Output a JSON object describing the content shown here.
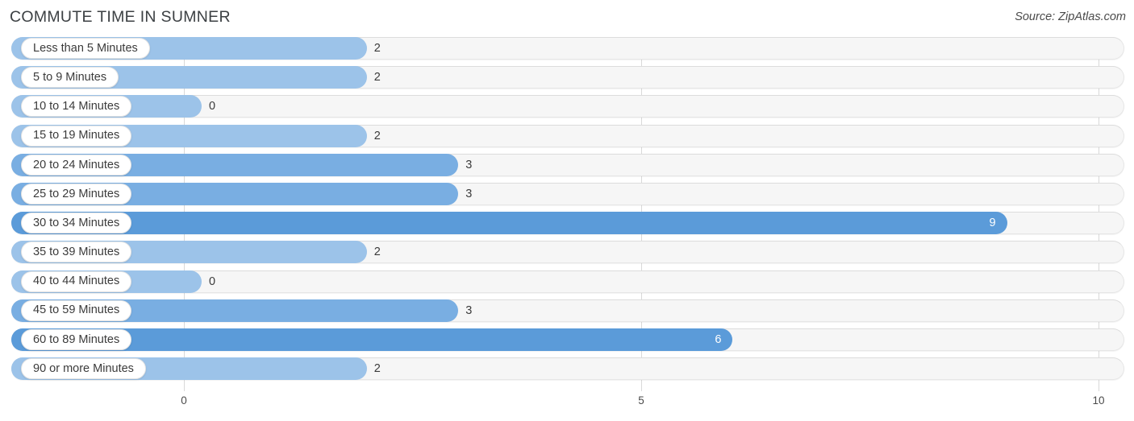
{
  "header": {
    "title": "COMMUTE TIME IN SUMNER",
    "source": "Source: ZipAtlas.com"
  },
  "axis": {
    "ticks": [
      "0",
      "5",
      "10"
    ],
    "tick_values": [
      0,
      5,
      10
    ]
  },
  "colors": {
    "bar_light": "#9cc3e9",
    "bar_mid": "#79aee2",
    "bar_dark": "#5b9bd9",
    "track": "#f6f6f6",
    "gridline": "#d9d9d9",
    "text": "#3b3b3b"
  },
  "chart_data": {
    "type": "bar",
    "title": "COMMUTE TIME IN SUMNER",
    "orientation": "horizontal",
    "xlabel": "",
    "ylabel": "",
    "xlim": [
      0,
      10
    ],
    "grid": true,
    "legend": "none",
    "categories": [
      "Less than 5 Minutes",
      "5 to 9 Minutes",
      "10 to 14 Minutes",
      "15 to 19 Minutes",
      "20 to 24 Minutes",
      "25 to 29 Minutes",
      "30 to 34 Minutes",
      "35 to 39 Minutes",
      "40 to 44 Minutes",
      "45 to 59 Minutes",
      "60 to 89 Minutes",
      "90 or more Minutes"
    ],
    "values": [
      2,
      2,
      0,
      2,
      3,
      3,
      9,
      2,
      0,
      3,
      6,
      2
    ],
    "value_labels": [
      "2",
      "2",
      "0",
      "2",
      "3",
      "3",
      "9",
      "2",
      "0",
      "3",
      "6",
      "2"
    ]
  },
  "rows": [
    {
      "label": "Less than 5 Minutes",
      "value": 2,
      "value_label": "2",
      "shade": "light",
      "label_inside": false
    },
    {
      "label": "5 to 9 Minutes",
      "value": 2,
      "value_label": "2",
      "shade": "light",
      "label_inside": false
    },
    {
      "label": "10 to 14 Minutes",
      "value": 0,
      "value_label": "0",
      "shade": "light",
      "label_inside": false
    },
    {
      "label": "15 to 19 Minutes",
      "value": 2,
      "value_label": "2",
      "shade": "light",
      "label_inside": false
    },
    {
      "label": "20 to 24 Minutes",
      "value": 3,
      "value_label": "3",
      "shade": "mid",
      "label_inside": false
    },
    {
      "label": "25 to 29 Minutes",
      "value": 3,
      "value_label": "3",
      "shade": "mid",
      "label_inside": false
    },
    {
      "label": "30 to 34 Minutes",
      "value": 9,
      "value_label": "9",
      "shade": "dark",
      "label_inside": true
    },
    {
      "label": "35 to 39 Minutes",
      "value": 2,
      "value_label": "2",
      "shade": "light",
      "label_inside": false
    },
    {
      "label": "40 to 44 Minutes",
      "value": 0,
      "value_label": "0",
      "shade": "light",
      "label_inside": false
    },
    {
      "label": "45 to 59 Minutes",
      "value": 3,
      "value_label": "3",
      "shade": "mid",
      "label_inside": false
    },
    {
      "label": "60 to 89 Minutes",
      "value": 6,
      "value_label": "6",
      "shade": "dark",
      "label_inside": true
    },
    {
      "label": "90 or more Minutes",
      "value": 2,
      "value_label": "2",
      "shade": "light",
      "label_inside": false
    }
  ]
}
